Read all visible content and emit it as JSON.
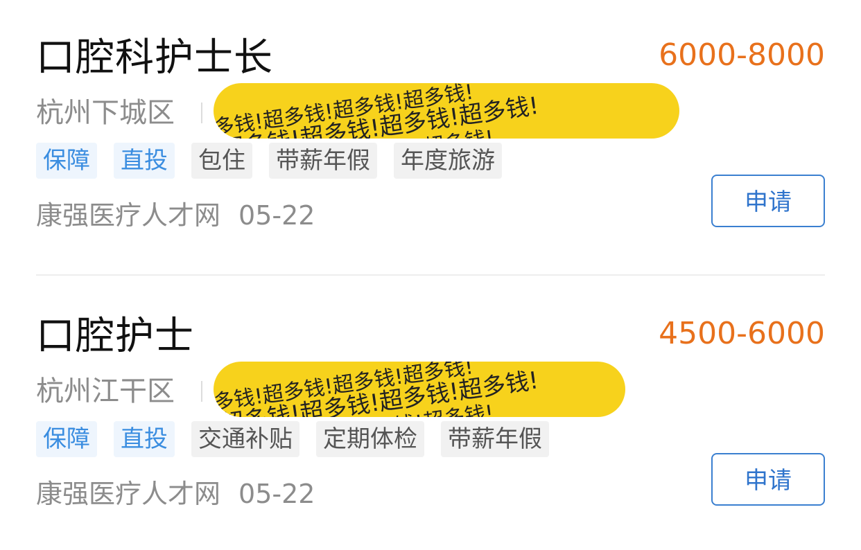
{
  "jobs": [
    {
      "title": "口腔科护士长",
      "salary": "6000-8000",
      "location": "杭州下城区",
      "redaction_text": "超多钱!超多钱!超多钱!超多钱!",
      "tags": [
        {
          "label": "保障",
          "style": "blue"
        },
        {
          "label": "直投",
          "style": "blue"
        },
        {
          "label": "包住",
          "style": "gray"
        },
        {
          "label": "带薪年假",
          "style": "gray"
        },
        {
          "label": "年度旅游",
          "style": "gray"
        }
      ],
      "source": "康强医疗人才网",
      "date": "05-22",
      "apply_label": "申请"
    },
    {
      "title": "口腔护士",
      "salary": "4500-6000",
      "location": "杭州江干区",
      "redaction_text": "超多钱!超多钱!超多钱!超多钱!",
      "tags": [
        {
          "label": "保障",
          "style": "blue"
        },
        {
          "label": "直投",
          "style": "blue"
        },
        {
          "label": "交通补贴",
          "style": "gray"
        },
        {
          "label": "定期体检",
          "style": "gray"
        },
        {
          "label": "带薪年假",
          "style": "gray"
        }
      ],
      "source": "康强医疗人才网",
      "date": "05-22",
      "apply_label": "申请"
    }
  ],
  "colors": {
    "salary": "#e8711c",
    "accent_blue": "#3a8de0",
    "redaction_yellow": "#f7d21c",
    "title": "#111111",
    "muted": "#8c8c8c"
  }
}
